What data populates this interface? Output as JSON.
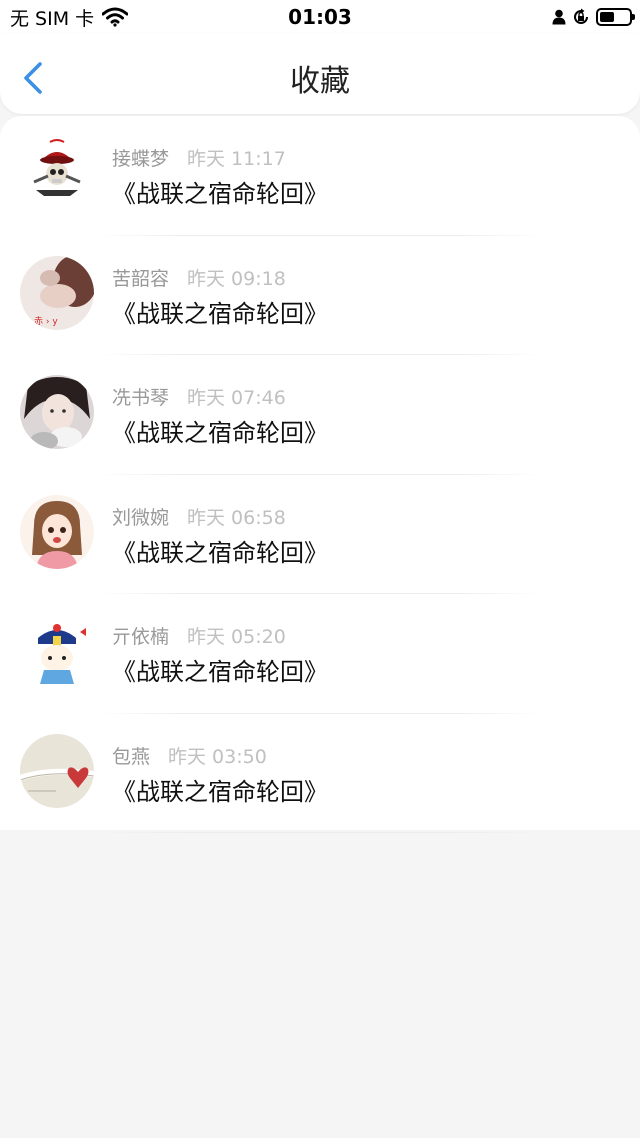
{
  "status_bar": {
    "carrier": "无 SIM 卡",
    "time": "01:03",
    "battery_level": 0.5
  },
  "nav": {
    "title": "收藏",
    "back_icon": "chevron-left-icon",
    "accent_color": "#3b8fe6"
  },
  "favorites": [
    {
      "name": "接蝶梦",
      "time": "昨天 11:17",
      "title": "《战联之宿命轮回》",
      "avatar": "pirate-skull"
    },
    {
      "name": "苦韶容",
      "time": "昨天 09:18",
      "title": "《战联之宿命轮回》",
      "avatar": "photo-hand"
    },
    {
      "name": "冼书琴",
      "time": "昨天 07:46",
      "title": "《战联之宿命轮回》",
      "avatar": "photo-girl"
    },
    {
      "name": "刘微婉",
      "time": "昨天 06:58",
      "title": "《战联之宿命轮回》",
      "avatar": "cartoon-girl"
    },
    {
      "name": "亓依楠",
      "time": "昨天 05:20",
      "title": "《战联之宿命轮回》",
      "avatar": "cartoon-zombie"
    },
    {
      "name": "包燕",
      "time": "昨天 03:50",
      "title": "《战联之宿命轮回》",
      "avatar": "heart-photo"
    }
  ]
}
